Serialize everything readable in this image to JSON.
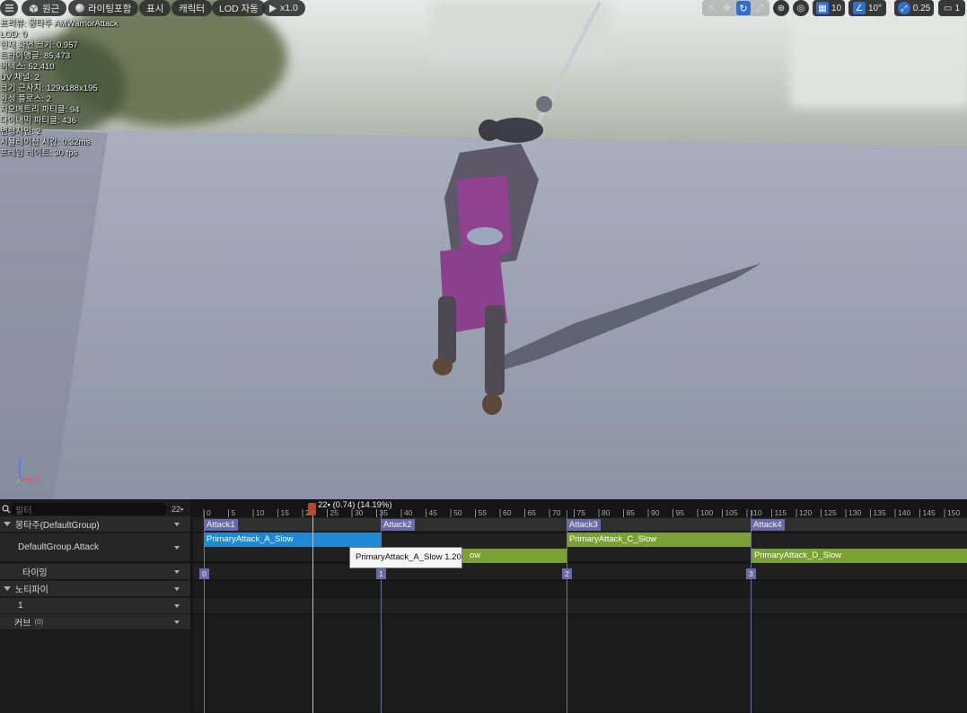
{
  "toolbar": {
    "menu_icon": "hamburger-icon",
    "perspective": {
      "icon": "cube-icon",
      "label": "원근"
    },
    "lighting": {
      "icon": "sphere-icon",
      "label": "라이팅포함"
    },
    "show": {
      "label": "표시"
    },
    "character": {
      "label": "캐릭터"
    },
    "lod": {
      "label": "LOD 자동"
    },
    "playback": {
      "icon": "play-icon",
      "label": "x1.0"
    },
    "transform_tools": [
      "select-icon",
      "move-icon",
      "rotate-icon",
      "scale-icon"
    ],
    "grid_snap_value": "10",
    "rotation_snap_value": "10°",
    "scale_snap_value": "0.25",
    "camera_speed": "1"
  },
  "stats": [
    "프리뷰: 몽타주 AMWarriorAttack",
    "LOD: 0",
    "현재 화면 크기: 0.957",
    "트라이앵글: 85,473",
    "버텍스: 52,410",
    "UV 채널: 2",
    "크기 근사치: 129x188x195",
    "완성 플로스: 2",
    "지오메트리 파티클: 94",
    "다이내믹 파티클: 436",
    "변형자인: 2",
    "시뮬레이션 시간: 0.32ms",
    "프레임 레이트: 30 fps"
  ],
  "axis": {
    "x_label": "X",
    "z_label": "Z"
  },
  "filter": {
    "placeholder": "필터",
    "count": "22▪"
  },
  "tracks": {
    "montage_group": "몽타주(DefaultGroup)",
    "slot": "DefaultGroup.Attack",
    "timing": "타이밍",
    "notifies": "노티파이",
    "notify_track": "1",
    "curves": "커브",
    "curves_count": "(0)"
  },
  "scrubber": {
    "label": "22▪ (0.74) (14.19%)"
  },
  "ruler_labels": [
    "0",
    "5",
    "10",
    "15",
    "20",
    "25",
    "30",
    "35",
    "40",
    "45",
    "50",
    "55",
    "60",
    "65",
    "70",
    "75",
    "80",
    "85",
    "90",
    "95",
    "100",
    "105",
    "110",
    "115",
    "120",
    "125",
    "130",
    "135",
    "140",
    "145",
    "150"
  ],
  "sections": [
    {
      "name": "Attack1"
    },
    {
      "name": "Attack2"
    },
    {
      "name": "Attack3"
    },
    {
      "name": "Attack4"
    }
  ],
  "segments": {
    "a": "PrimaryAttack_A_Slow",
    "b_visible": "ow",
    "c": "PrimaryAttack_C_Slow",
    "d": "PrimaryAttack_D_Slow"
  },
  "section_indices": [
    "0",
    "1",
    "2",
    "3"
  ],
  "tooltip": "PrimaryAttack_A_Slow 1.20",
  "colors": {
    "segment_blue": "#1f8ad4",
    "segment_green": "#7ba135",
    "section_purple": "#6a6aa8",
    "scrubber_red": "#c0452f",
    "toolbar_accent": "#2f6fd1"
  }
}
